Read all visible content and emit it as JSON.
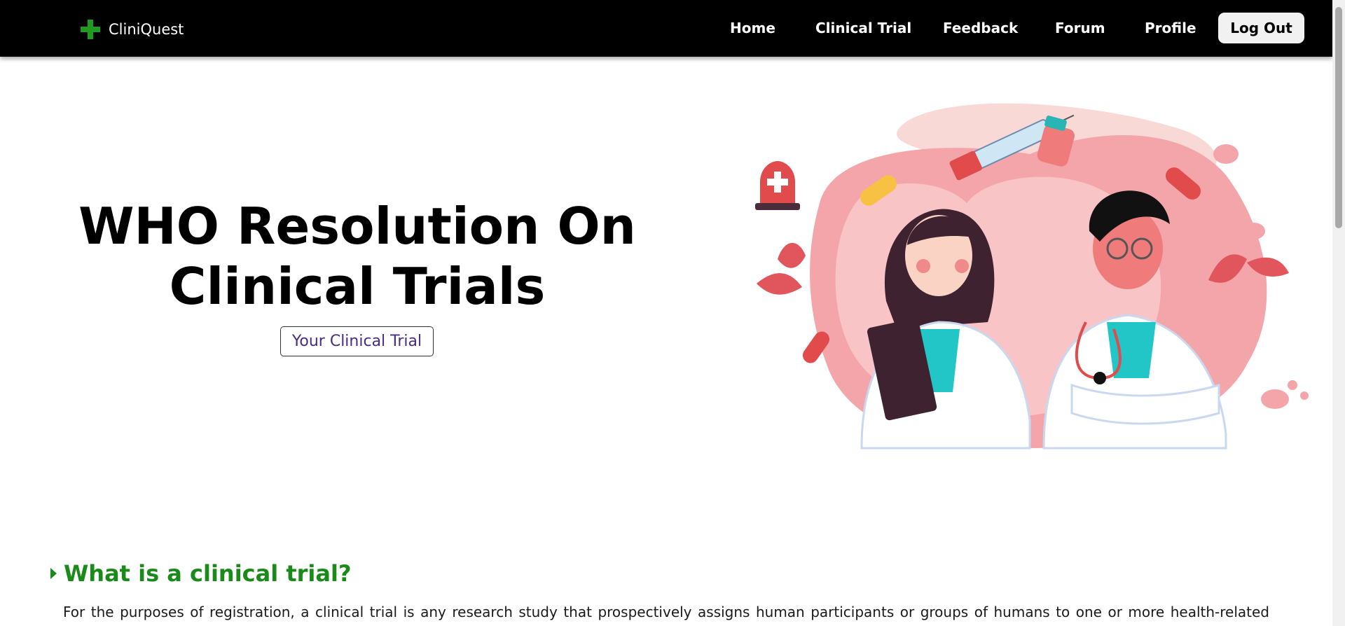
{
  "brand": {
    "name": "CliniQuest",
    "icon": "green-cross-icon",
    "icon_color": "#1f9a1f"
  },
  "nav": {
    "home": "Home",
    "clinical_trial": "Clinical Trial",
    "feedback": "Feedback",
    "forum": "Forum",
    "profile": "Profile",
    "logout": "Log Out"
  },
  "hero": {
    "title_line1": "WHO Resolution On",
    "title_line2": "Clinical Trials",
    "button": "Your Clinical Trial",
    "illustration": "doctors-illustration"
  },
  "section": {
    "title": "What is a clinical trial?",
    "toggle_icon": "caret-right-icon",
    "body": "For the purposes of registration, a clinical trial is any research study that prospectively assigns human participants or groups of humans to one or more health-related"
  },
  "colors": {
    "navbar": "#000000",
    "accent_green": "#1a8a1a",
    "button_text": "#4a2c83"
  }
}
